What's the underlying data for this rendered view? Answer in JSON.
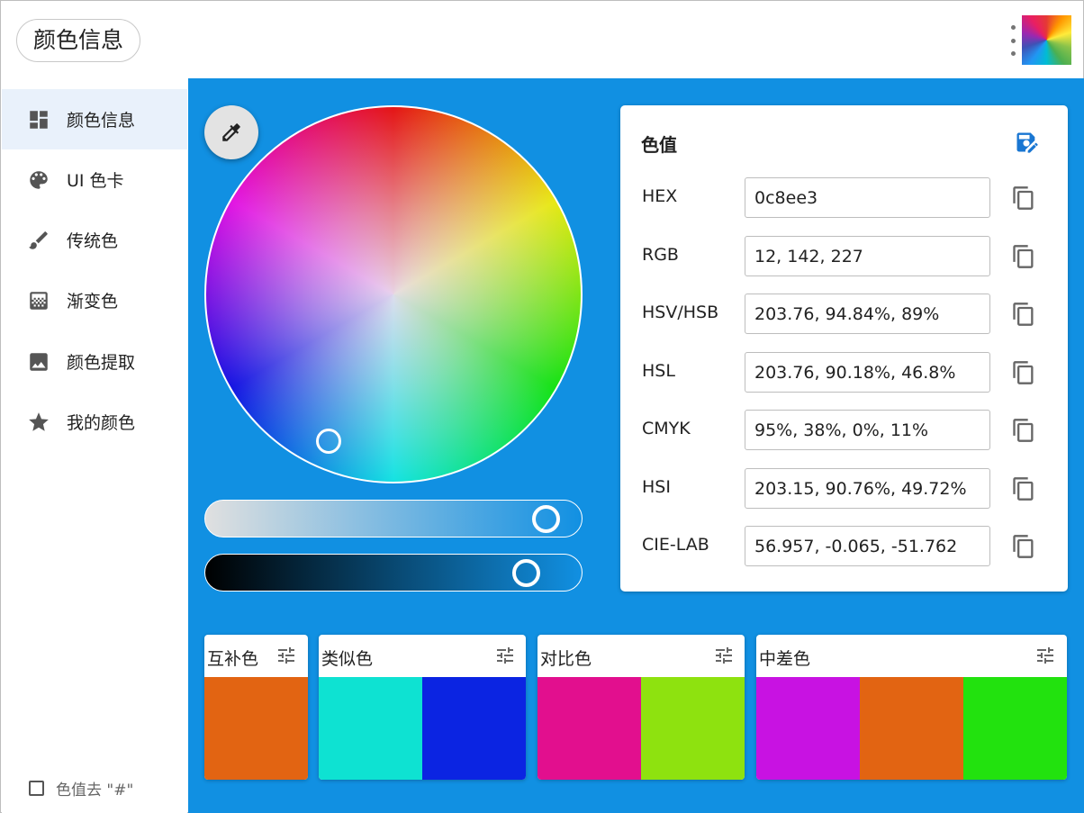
{
  "app": {
    "title": "颜色信息"
  },
  "sidebar": {
    "items": [
      {
        "label": "颜色信息",
        "icon": "dashboard-icon",
        "active": true
      },
      {
        "label": "UI 色卡",
        "icon": "palette-icon",
        "active": false
      },
      {
        "label": "传统色",
        "icon": "brush-icon",
        "active": false
      },
      {
        "label": "渐变色",
        "icon": "gradient-icon",
        "active": false
      },
      {
        "label": "颜色提取",
        "icon": "image-icon",
        "active": false
      },
      {
        "label": "我的颜色",
        "icon": "star-icon",
        "active": false
      }
    ],
    "strip_hash_label": "色值去 \"#\"",
    "strip_hash_checked": false
  },
  "picker": {
    "current_color": "#0c8ee3",
    "saturation_level": 0.9484,
    "brightness_level": 0.89
  },
  "values": {
    "title": "色值",
    "rows": [
      {
        "label": "HEX",
        "value": "0c8ee3"
      },
      {
        "label": "RGB",
        "value": "12, 142, 227"
      },
      {
        "label": "HSV/HSB",
        "value": "203.76, 94.84%, 89%"
      },
      {
        "label": "HSL",
        "value": "203.76, 90.18%, 46.8%"
      },
      {
        "label": "CMYK",
        "value": "95%, 38%, 0%, 11%"
      },
      {
        "label": "HSI",
        "value": "203.15, 90.76%, 49.72%"
      },
      {
        "label": "CIE-LAB",
        "value": "56.957, -0.065, -51.762"
      }
    ]
  },
  "schemes": [
    {
      "title": "互补色",
      "colors": [
        "#e26412"
      ]
    },
    {
      "title": "类似色",
      "colors": [
        "#0ee2d2",
        "#0b24e2"
      ]
    },
    {
      "title": "对比色",
      "colors": [
        "#e20f8e",
        "#8ee20f"
      ]
    },
    {
      "title": "中差色",
      "colors": [
        "#c812e2",
        "#e26412",
        "#22e20e"
      ]
    }
  ],
  "colors": {
    "accent": "#1190e2",
    "sidebar_active_bg": "#e9f1fb",
    "save_icon": "#1976d2"
  }
}
